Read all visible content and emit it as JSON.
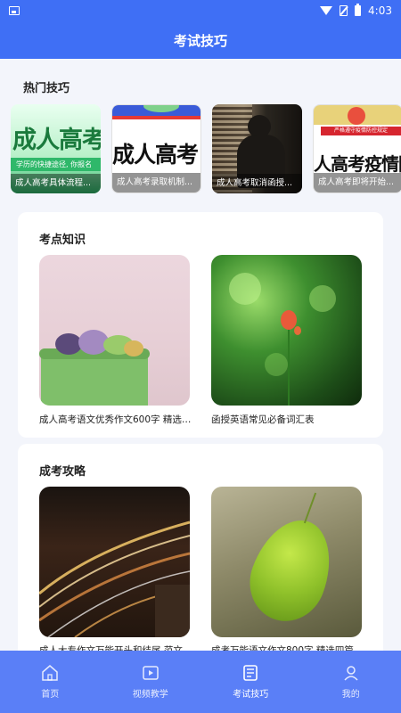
{
  "status_bar": {
    "time": "4:03"
  },
  "header": {
    "title": "考试技巧"
  },
  "hot": {
    "title": "热门技巧",
    "cards": [
      {
        "caption": "成人高考具体流程...",
        "big_text": "成人高考",
        "sub_text": "学历的快捷途径, 你报名",
        "banner": ""
      },
      {
        "caption": "成人高考录取机制...",
        "big_text": "成人高考",
        "sub_text": "",
        "banner": ""
      },
      {
        "caption": "成人高考取消函授...",
        "big_text": "",
        "sub_text": "",
        "banner": ""
      },
      {
        "caption": "成人高考即将开始...",
        "big_text": "人高考疫情防",
        "sub_text": "",
        "banner": "严格遵守疫情防控规定"
      }
    ]
  },
  "knowledge": {
    "title": "考点知识",
    "items": [
      {
        "caption": "成人高考语文优秀作文600字 精选三..."
      },
      {
        "caption": "函授英语常见必备词汇表"
      }
    ]
  },
  "strategy": {
    "title": "成考攻略",
    "items": [
      {
        "caption": "成人大专作文万能开头和结尾 范文..."
      },
      {
        "caption": "成考万能语文作文800字 精选四篇优..."
      }
    ]
  },
  "nav": {
    "items": [
      {
        "label": "首页",
        "icon": "home-icon"
      },
      {
        "label": "视频教学",
        "icon": "video-icon"
      },
      {
        "label": "考试技巧",
        "icon": "tips-icon",
        "active": true
      },
      {
        "label": "我的",
        "icon": "profile-icon"
      }
    ]
  },
  "colors": {
    "primary": "#3f6ff5",
    "nav_bg": "#5a7ff7",
    "page_bg": "#f3f5fb"
  }
}
